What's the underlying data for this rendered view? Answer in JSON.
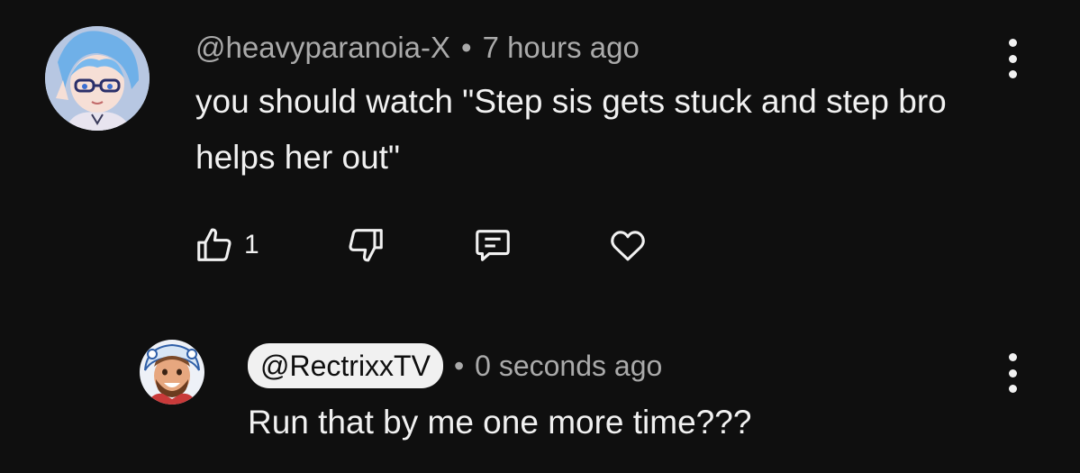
{
  "comment": {
    "author": "@heavyparanoia-X",
    "separator": "•",
    "time": "7 hours ago",
    "text": "you should watch \"Step sis gets stuck and step bro helps her out\"",
    "like_count": "1"
  },
  "reply": {
    "author": "@RectrixxTV",
    "separator": "•",
    "time": "0 seconds ago",
    "text": "Run that by me one more time???"
  },
  "icons": {
    "more": "vertical-ellipsis-icon",
    "like": "thumbs-up-icon",
    "dislike": "thumbs-down-icon",
    "reply": "comment-icon",
    "heart": "heart-icon"
  },
  "colors": {
    "background": "#0f0f0f",
    "text_primary": "#f1f1f1",
    "text_secondary": "#aaaaaa",
    "pill_background": "#f1f1f1"
  }
}
